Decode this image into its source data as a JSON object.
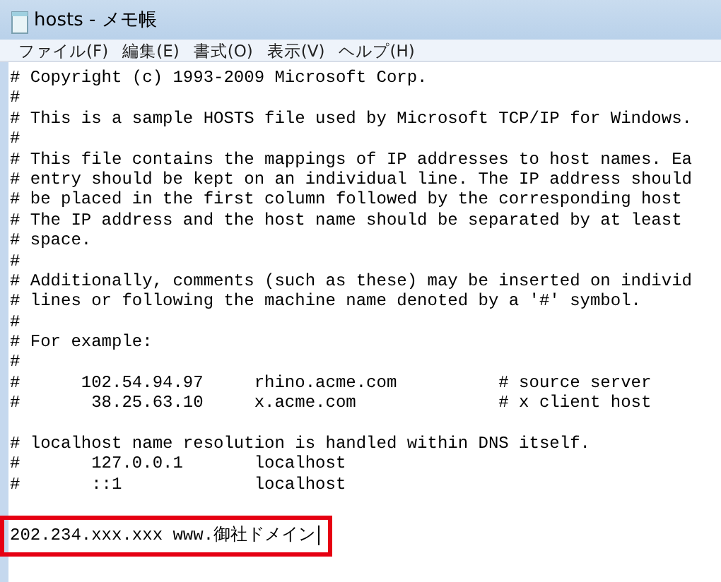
{
  "window": {
    "title": "hosts - メモ帳"
  },
  "menu": [
    "ファイル(F)",
    "編集(E)",
    "書式(O)",
    "表示(V)",
    "ヘルプ(H)"
  ],
  "lines": [
    {
      "text": "# Copyright (c) 1993-2009 Microsoft Corp.",
      "blank_before": false,
      "highlighted": false
    },
    {
      "text": "#",
      "blank_before": false,
      "highlighted": false
    },
    {
      "text": "# This is a sample HOSTS file used by Microsoft TCP/IP for Windows.",
      "blank_before": false,
      "highlighted": false
    },
    {
      "text": "#",
      "blank_before": false,
      "highlighted": false
    },
    {
      "text": "# This file contains the mappings of IP addresses to host names. Ea",
      "blank_before": false,
      "highlighted": false
    },
    {
      "text": "# entry should be kept on an individual line. The IP address should",
      "blank_before": false,
      "highlighted": false
    },
    {
      "text": "# be placed in the first column followed by the corresponding host",
      "blank_before": false,
      "highlighted": false
    },
    {
      "text": "# The IP address and the host name should be separated by at least",
      "blank_before": false,
      "highlighted": false
    },
    {
      "text": "# space.",
      "blank_before": false,
      "highlighted": false
    },
    {
      "text": "#",
      "blank_before": false,
      "highlighted": false
    },
    {
      "text": "# Additionally, comments (such as these) may be inserted on individ",
      "blank_before": false,
      "highlighted": false
    },
    {
      "text": "# lines or following the machine name denoted by a '#' symbol.",
      "blank_before": false,
      "highlighted": false
    },
    {
      "text": "#",
      "blank_before": false,
      "highlighted": false
    },
    {
      "text": "# For example:",
      "blank_before": false,
      "highlighted": false
    },
    {
      "text": "#",
      "blank_before": false,
      "highlighted": false
    },
    {
      "text": "#      102.54.94.97     rhino.acme.com          # source server",
      "blank_before": false,
      "highlighted": false
    },
    {
      "text": "#       38.25.63.10     x.acme.com              # x client host",
      "blank_before": false,
      "highlighted": false
    },
    {
      "text": "# localhost name resolution is handled within DNS itself.",
      "blank_before": true,
      "highlighted": false
    },
    {
      "text": "#       127.0.0.1       localhost",
      "blank_before": false,
      "highlighted": false
    },
    {
      "text": "#       ::1             localhost",
      "blank_before": false,
      "highlighted": false
    },
    {
      "text": "202.234.xxx.xxx www.御社ドメイン",
      "blank_before": true,
      "highlighted": true
    }
  ]
}
